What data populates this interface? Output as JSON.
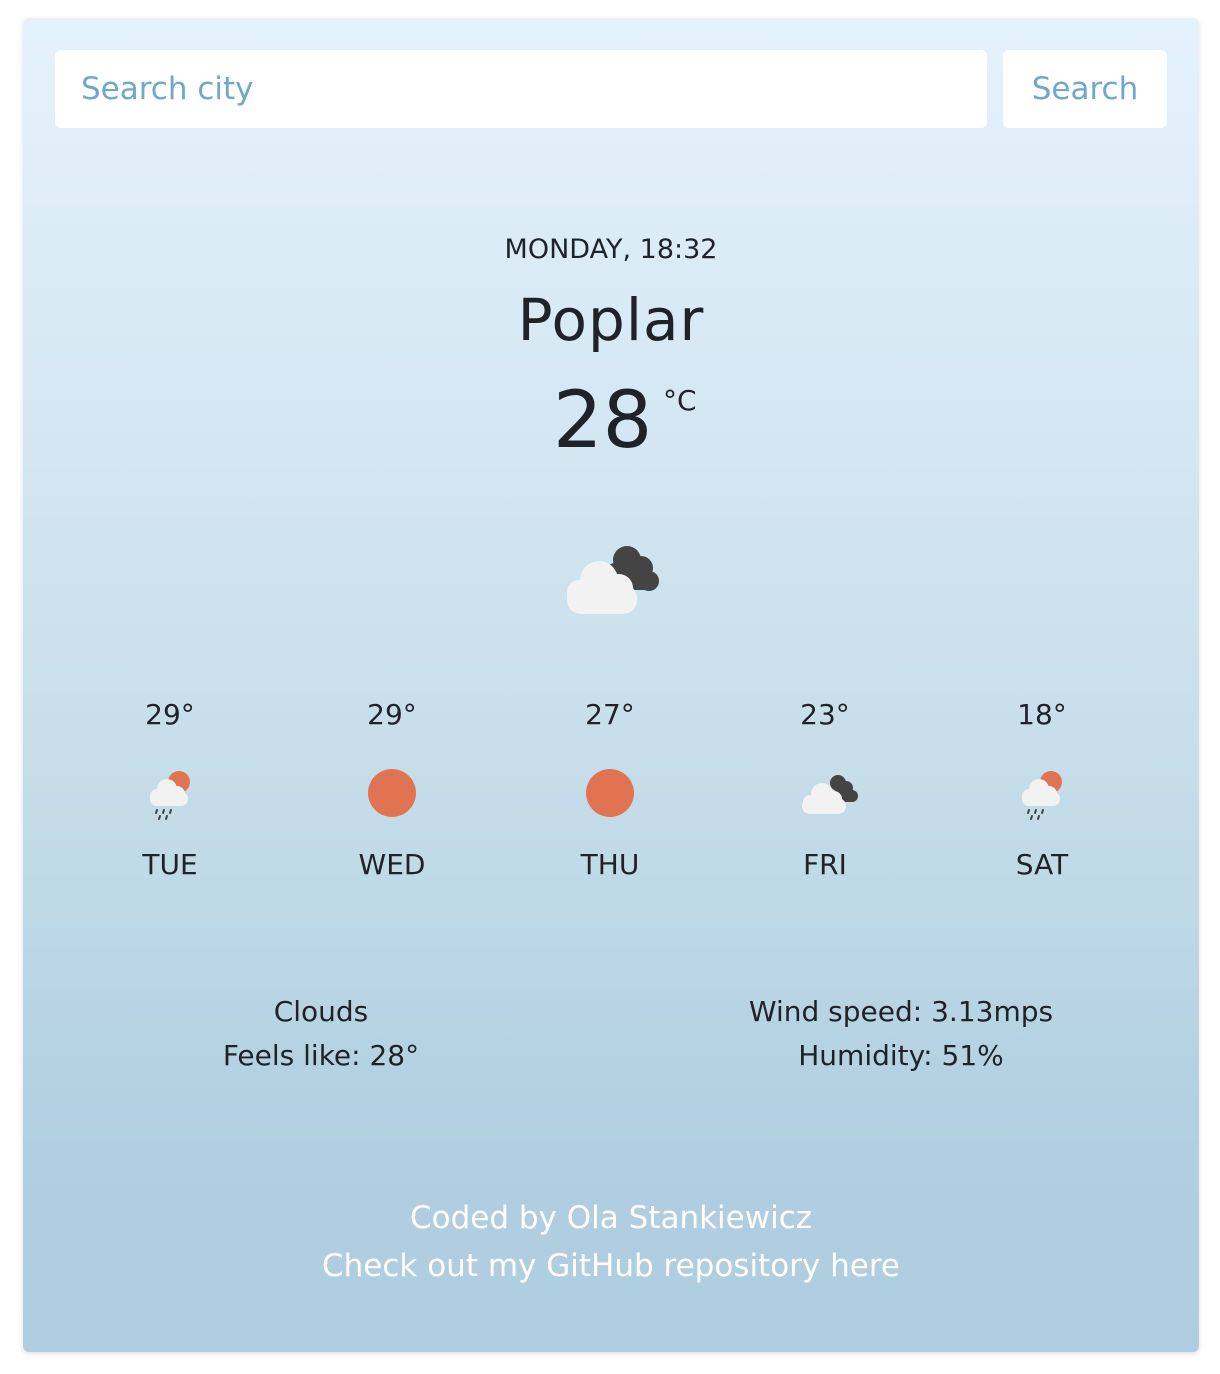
{
  "search": {
    "placeholder": "Search city",
    "button_label": "Search"
  },
  "current": {
    "datetime": "MONDAY, 18:32",
    "city": "Poplar",
    "temperature": "28",
    "unit": "°C",
    "icon": "cloudy-icon"
  },
  "forecast": [
    {
      "temp": "29°",
      "day": "TUE",
      "icon": "rain-sun-icon"
    },
    {
      "temp": "29°",
      "day": "WED",
      "icon": "sun-icon"
    },
    {
      "temp": "27°",
      "day": "THU",
      "icon": "sun-icon"
    },
    {
      "temp": "23°",
      "day": "FRI",
      "icon": "cloudy-icon"
    },
    {
      "temp": "18°",
      "day": "SAT",
      "icon": "rain-sun-icon"
    }
  ],
  "details": {
    "description": "Clouds",
    "feels_like": "Feels like: 28°",
    "wind": "Wind speed: 3.13mps",
    "humidity": "Humidity: 51%"
  },
  "footer": {
    "credit": "Coded by Ola Stankiewicz",
    "repo_link": "Check out my GitHub repository here"
  },
  "colors": {
    "accent": "#6fa8c8",
    "sun": "#e07352",
    "cloud_light": "#f2f2f2",
    "cloud_dark": "#444444"
  }
}
